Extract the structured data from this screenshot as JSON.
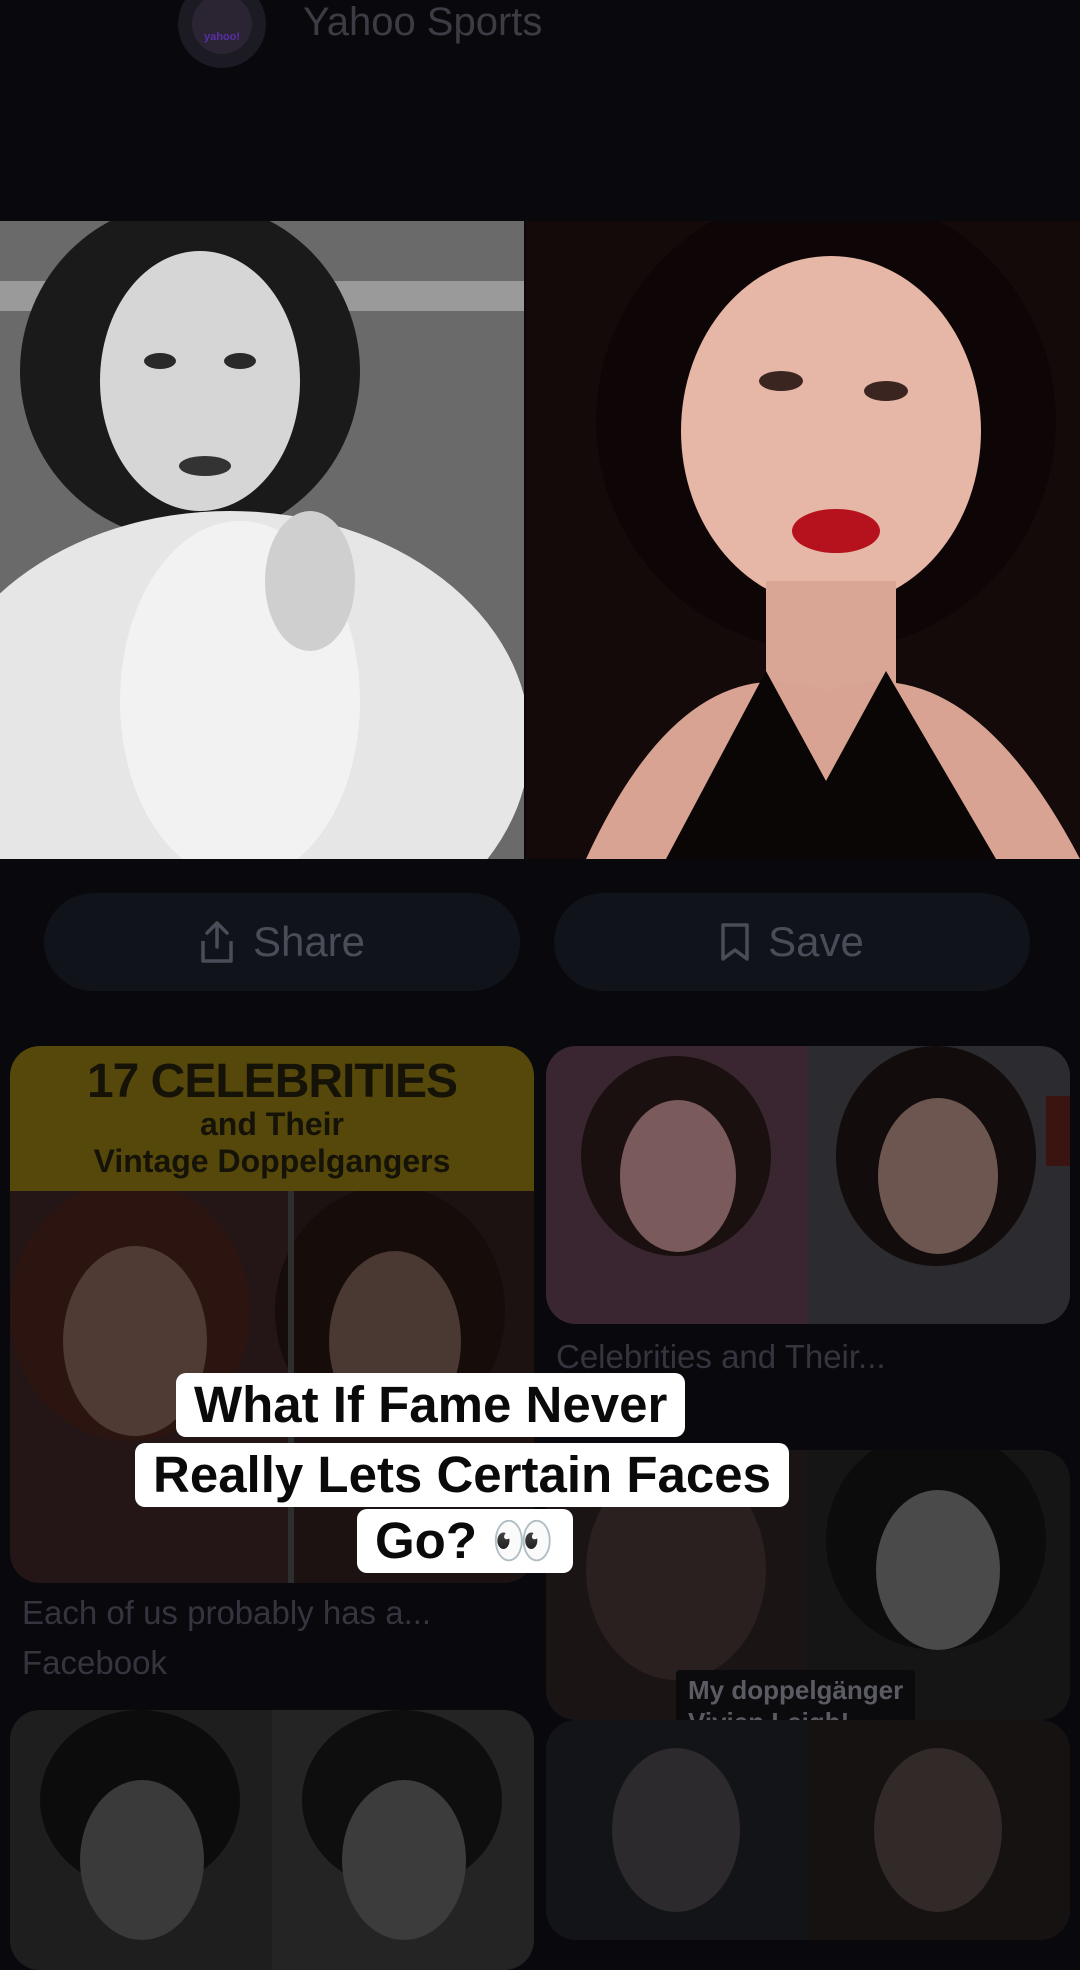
{
  "header": {
    "source_name": "Yahoo Sports",
    "avatar_text": "yahoo!"
  },
  "actions": {
    "share_label": "Share",
    "save_label": "Save"
  },
  "cards": {
    "left_banner": {
      "line1": "17 CELEBRITIES",
      "line2": "and Their",
      "line3": "Vintage Doppelgangers"
    },
    "left_caption": "Each of us probably has a...",
    "left_source": "Facebook",
    "right_caption": "Celebrities and Their...",
    "overlay_tag": {
      "line1": "My doppelgänger",
      "line2": "Vivien Leigh!"
    }
  },
  "caption": {
    "line1": "What If Fame Never",
    "line2": "Really Lets Certain Faces",
    "line3": "Go? 👀"
  },
  "colors": {
    "background": "#09080d",
    "banner": "#56480a",
    "caption_bg": "#ffffff"
  }
}
